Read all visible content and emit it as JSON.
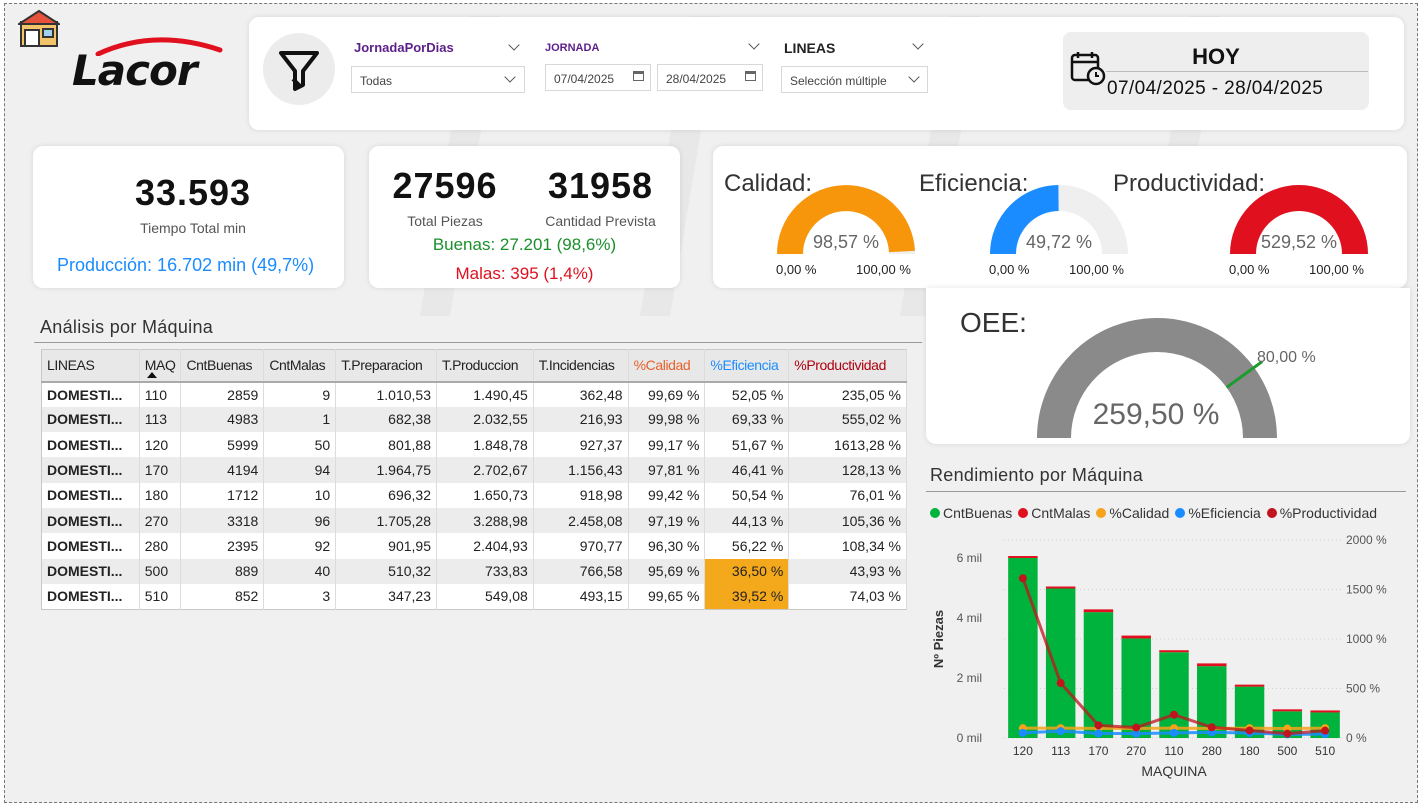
{
  "header": {
    "logo_text": "Lacor",
    "slicers": {
      "jornada_por_dias": {
        "title": "JornadaPorDias",
        "value": "Todas"
      },
      "jornada": {
        "title": "JORNADA",
        "from": "07/04/2025",
        "to": "28/04/2025"
      },
      "lineas": {
        "title": "LINEAS",
        "value": "Selección múltiple"
      }
    },
    "date_card": {
      "title": "HOY",
      "range": "07/04/2025 - 28/04/2025"
    }
  },
  "kpis": {
    "tiempo_total": {
      "value": "33.593",
      "label": "Tiempo Total min",
      "produccion": "Producción: 16.702 min (49,7%)"
    },
    "piezas": {
      "total_value": "27596",
      "total_label": "Total Piezas",
      "prevista_value": "31958",
      "prevista_label": "Cantidad Prevista",
      "buenas": "Buenas: 27.201 (98,6%)",
      "malas": "Malas: 395 (1,4%)"
    }
  },
  "gauges": {
    "calidad": {
      "title": "Calidad:",
      "value": "98,57 %",
      "min": "0,00 %",
      "max": "100,00 %",
      "fraction": 0.9857,
      "color": "#f7960b"
    },
    "eficiencia": {
      "title": "Eficiencia:",
      "value": "49,72 %",
      "min": "0,00 %",
      "max": "100,00 %",
      "fraction": 0.4972,
      "color": "#1a8cff"
    },
    "productividad": {
      "title": "Productividad:",
      "value": "529,52 %",
      "min": "0,00 %",
      "max": "100,00 %",
      "fraction": 1.0,
      "color": "#e0101e"
    },
    "oee": {
      "title": "OEE:",
      "value": "259,50 %",
      "target": "80,00 %",
      "target_fraction": 0.8,
      "fraction": 1.0,
      "color": "#8a8a8a"
    }
  },
  "table": {
    "title": "Análisis por Máquina",
    "columns": [
      "LINEAS",
      "MAQ",
      "CntBuenas",
      "CntMalas",
      "T.Preparacion",
      "T.Produccion",
      "T.Incidencias",
      "%Calidad",
      "%Eficiencia",
      "%Productividad"
    ],
    "header_colors": {
      "calidad": "#e8602c",
      "eficiencia": "#1a8cff",
      "productividad": "#b00010"
    },
    "highlight_color": "#f4a81c",
    "rows": [
      [
        "DOMESTI...",
        "110",
        "2859",
        "9",
        "1.010,53",
        "1.490,45",
        "362,48",
        "99,69 %",
        "52,05 %",
        "235,05 %"
      ],
      [
        "DOMESTI...",
        "113",
        "4983",
        "1",
        "682,38",
        "2.032,55",
        "216,93",
        "99,98 %",
        "69,33 %",
        "555,02 %"
      ],
      [
        "DOMESTI...",
        "120",
        "5999",
        "50",
        "801,88",
        "1.848,78",
        "927,37",
        "99,17 %",
        "51,67 %",
        "1613,28 %"
      ],
      [
        "DOMESTI...",
        "170",
        "4194",
        "94",
        "1.964,75",
        "2.702,67",
        "1.156,43",
        "97,81 %",
        "46,41 %",
        "128,13 %"
      ],
      [
        "DOMESTI...",
        "180",
        "1712",
        "10",
        "696,32",
        "1.650,73",
        "918,98",
        "99,42 %",
        "50,54 %",
        "76,01 %"
      ],
      [
        "DOMESTI...",
        "270",
        "3318",
        "96",
        "1.705,28",
        "3.288,98",
        "2.458,08",
        "97,19 %",
        "44,13 %",
        "105,36 %"
      ],
      [
        "DOMESTI...",
        "280",
        "2395",
        "92",
        "901,95",
        "2.404,93",
        "970,77",
        "96,30 %",
        "56,22 %",
        "108,34 %"
      ],
      [
        "DOMESTI...",
        "500",
        "889",
        "40",
        "510,32",
        "733,83",
        "766,58",
        "95,69 %",
        "36,50 %",
        "43,93 %"
      ],
      [
        "DOMESTI...",
        "510",
        "852",
        "3",
        "347,23",
        "549,08",
        "493,15",
        "99,65 %",
        "39,52 %",
        "74,03 %"
      ]
    ]
  },
  "chart_data": {
    "type": "bar",
    "title": "Rendimiento por Máquina",
    "xlabel": "MAQUINA",
    "ylabel": "Nº Piezas",
    "categories": [
      "120",
      "113",
      "170",
      "270",
      "110",
      "280",
      "180",
      "500",
      "510"
    ],
    "ylim": [
      0,
      6600
    ],
    "y2lim": [
      0,
      2000
    ],
    "yticks": [
      "0 mil",
      "2 mil",
      "4 mil",
      "6 mil"
    ],
    "y2ticks": [
      "0 %",
      "500 %",
      "1000 %",
      "1500 %",
      "2000 %"
    ],
    "legend_position": "top",
    "series": [
      {
        "name": "CntBuenas",
        "kind": "stacked-bar",
        "color": "#00b33c",
        "values": [
          5999,
          4983,
          4194,
          3318,
          2859,
          2395,
          1712,
          889,
          852
        ]
      },
      {
        "name": "CntMalas",
        "kind": "stacked-bar",
        "color": "#e0101e",
        "values": [
          50,
          1,
          94,
          96,
          9,
          92,
          10,
          40,
          3
        ]
      },
      {
        "name": "%Calidad",
        "kind": "line",
        "axis": "right",
        "color": "#f7a21b",
        "values": [
          99.17,
          99.98,
          97.81,
          97.19,
          99.69,
          96.3,
          99.42,
          95.69,
          99.65
        ]
      },
      {
        "name": "%Eficiencia",
        "kind": "line",
        "axis": "right",
        "color": "#1a8cff",
        "values": [
          51.67,
          69.33,
          46.41,
          44.13,
          52.05,
          56.22,
          50.54,
          36.5,
          39.52
        ]
      },
      {
        "name": "%Productividad",
        "kind": "line",
        "axis": "right",
        "color": "#c0141e",
        "values": [
          1613.28,
          555.02,
          128.13,
          105.36,
          235.05,
          108.34,
          76.01,
          43.93,
          74.03
        ]
      }
    ]
  }
}
